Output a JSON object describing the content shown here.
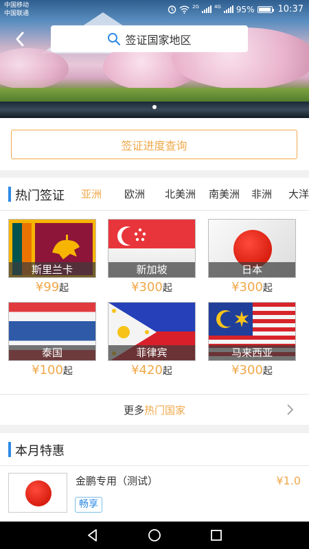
{
  "status_bar": {
    "carrier_1": "中国移动",
    "carrier_2": "中国联通",
    "network_1": "2G",
    "network_2": "4G",
    "battery": "95%",
    "time": "10:37"
  },
  "header": {
    "search_placeholder": "签证国家地区",
    "banner_pages": 1,
    "banner_active_index": 0
  },
  "query": {
    "label": "签证进度查询"
  },
  "hot": {
    "title": "热门签证",
    "tabs": [
      "亚洲",
      "欧洲",
      "北美洲",
      "南美洲",
      "非洲",
      "大洋"
    ],
    "active_tab": 0,
    "countries": [
      {
        "name": "斯里兰卡",
        "price": "¥99",
        "suffix": "起"
      },
      {
        "name": "新加坡",
        "price": "¥300",
        "suffix": "起"
      },
      {
        "name": "日本",
        "price": "¥300",
        "suffix": "起"
      },
      {
        "name": "泰国",
        "price": "¥100",
        "suffix": "起"
      },
      {
        "name": "菲律宾",
        "price": "¥420",
        "suffix": "起"
      },
      {
        "name": "马来西亚",
        "price": "¥300",
        "suffix": "起"
      }
    ],
    "more_prefix": "更多",
    "more_highlight": "热门国家"
  },
  "monthly": {
    "title": "本月特惠",
    "deal": {
      "title": "金鹏专用（测试）",
      "tag": "畅享",
      "price": "¥1.0"
    }
  },
  "colors": {
    "accent": "#f0a84a",
    "section_bar": "#2e8ae6",
    "tag_text": "#2e8ae6"
  }
}
